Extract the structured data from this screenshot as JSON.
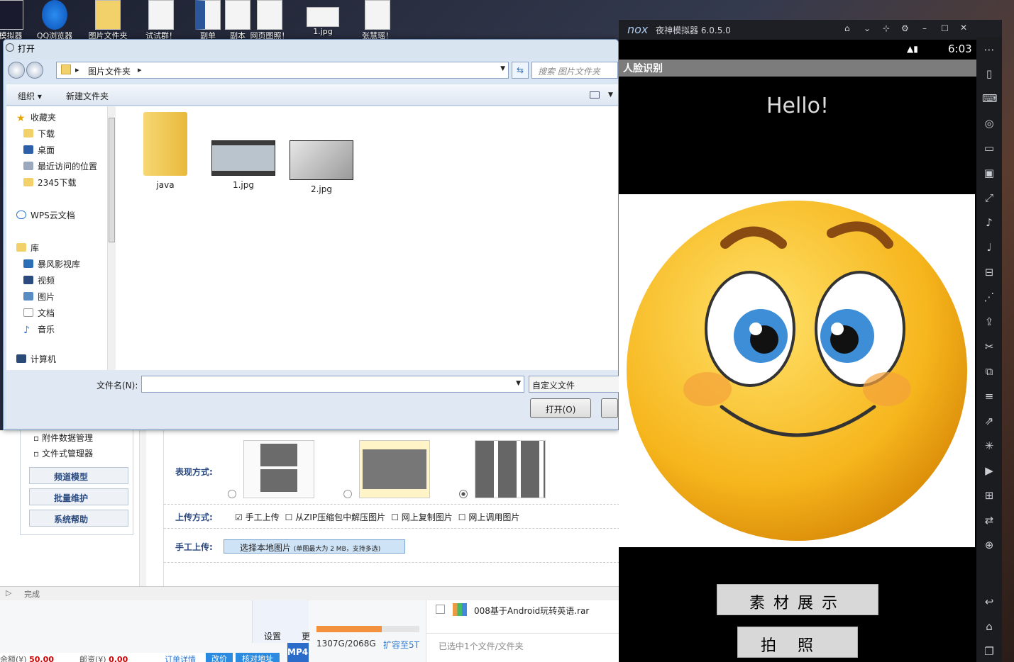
{
  "desktop": {
    "icons": [
      {
        "label": "模拟器"
      },
      {
        "label": "QQ浏览器"
      },
      {
        "label": "图片文件夹"
      },
      {
        "label": "试试群！"
      },
      {
        "label": "副单"
      },
      {
        "label": "副本"
      },
      {
        "label": "网页图照！"
      },
      {
        "label": "1.jpg"
      },
      {
        "label": "张慧瑶！"
      }
    ]
  },
  "dialog": {
    "title": "打开",
    "breadcrumb_folder": "图片文件夹",
    "search_placeholder": "搜索 图片文件夹",
    "toolbar": {
      "organize": "组织",
      "new_folder": "新建文件夹"
    },
    "nav": {
      "favorites": "收藏夹",
      "fav_items": [
        "下载",
        "桌面",
        "最近访问的位置",
        "2345下载"
      ],
      "wps": "WPS云文档",
      "library": "库",
      "lib_items": [
        "暴风影视库",
        "视频",
        "图片",
        "文档",
        "音乐"
      ],
      "computer": "计算机"
    },
    "files": [
      {
        "name": "java",
        "type": "folder"
      },
      {
        "name": "1.jpg",
        "type": "image"
      },
      {
        "name": "2.jpg",
        "type": "image"
      }
    ],
    "filename_label": "文件名(N):",
    "filename_value": "",
    "filetype_value": "自定义文件",
    "open_button": "打开(O)"
  },
  "webpage": {
    "tree_items": [
      "附件数据管理",
      "文件式管理器"
    ],
    "side_buttons": [
      "频道模型",
      "批量维护",
      "系统帮助"
    ],
    "display_label": "表现方式:",
    "upload_label": "上传方式:",
    "upload_options": [
      "手工上传",
      "从ZIP压缩包中解压图片",
      "网上复制图片",
      "网上调用图片"
    ],
    "manual_label": "手工上传:",
    "choose_button": "选择本地图片",
    "choose_hint": "(单图最大为 2 MB，支持多选)",
    "status": "完成"
  },
  "cloud": {
    "settings": "设置",
    "more": "更",
    "storage": "1307G/2068G",
    "storage_fraction": 0.632,
    "expand": "扩容至5T",
    "file_name": "008基于Android玩转英语.rar",
    "selected": "已选中1个文件/文件夹",
    "order_left": "余额(¥)",
    "order_amount": "50.00",
    "postage_label": "邮资(¥)",
    "postage_amount": "0.00",
    "order_detail": "订单详情",
    "btn1": "改价",
    "btn2": "核对地址"
  },
  "nox": {
    "brand": "nox",
    "title": "夜神模拟器 6.0.5.0",
    "time": "6:03",
    "app_title": "人脸识别",
    "hello": "Hello!",
    "btn_material": "素材展示",
    "btn_photo": "拍照"
  }
}
